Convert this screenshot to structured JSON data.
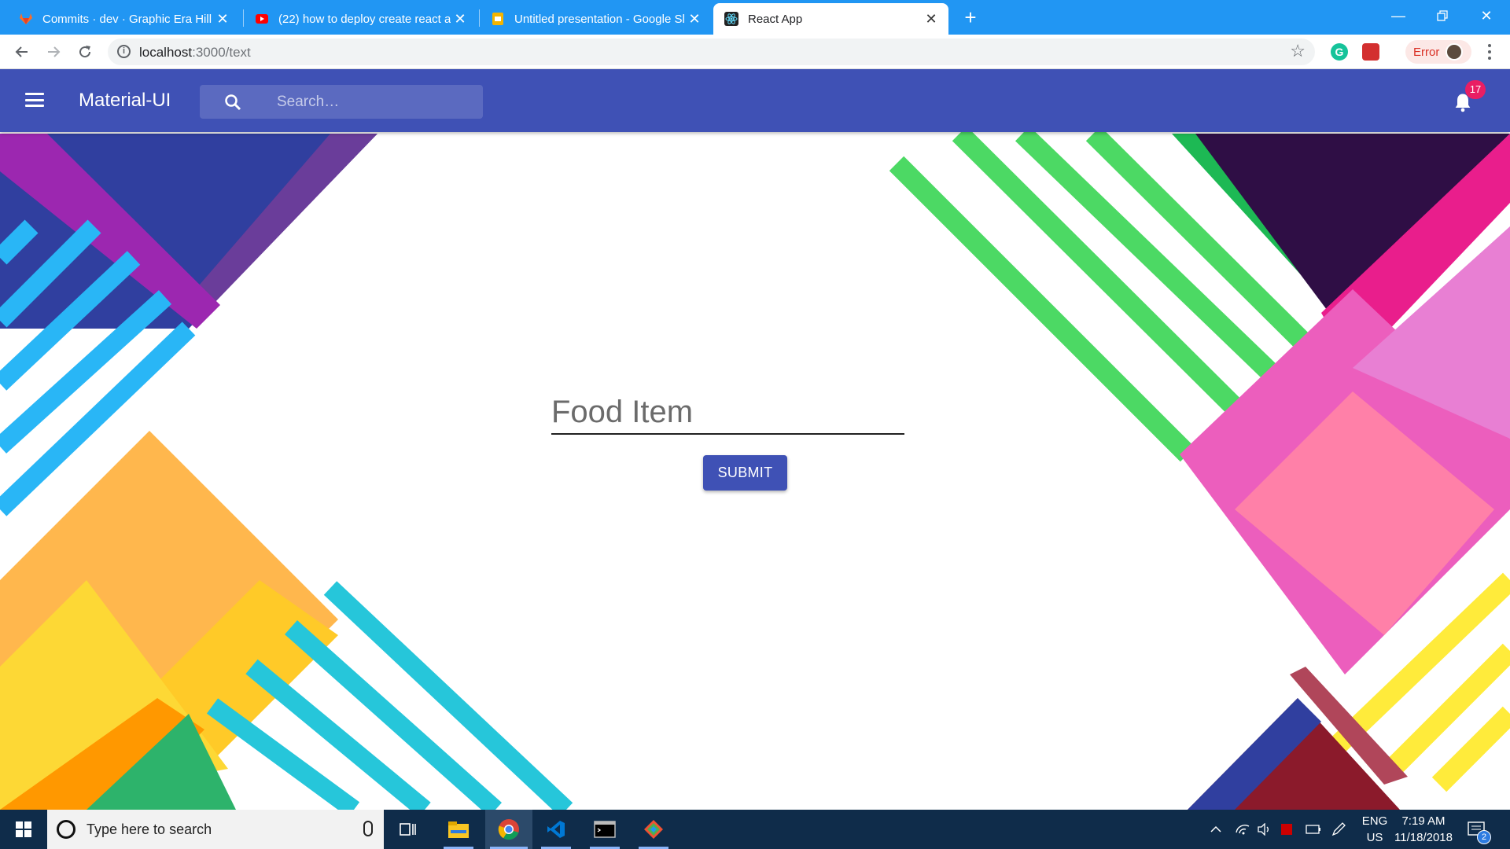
{
  "browser": {
    "tabs": [
      {
        "title": "Commits · dev · Graphic Era Hill U",
        "icon": "gitlab-icon"
      },
      {
        "title": "(22) how to deploy create react a",
        "icon": "youtube-icon"
      },
      {
        "title": "Untitled presentation - Google Sl",
        "icon": "google-slides-icon"
      },
      {
        "title": "React App",
        "icon": "react-icon",
        "active": true
      }
    ],
    "new_tab_label": "+",
    "url_host": "localhost",
    "url_path": ":3000/text",
    "profile_status": "Error"
  },
  "appbar": {
    "brand": "Material-UI",
    "search_placeholder": "Search…",
    "notification_count": "17",
    "color": "#3f51b5"
  },
  "form": {
    "field_placeholder": "Food Item",
    "submit_label": "SUBMIT"
  },
  "taskbar": {
    "search_placeholder": "Type here to search",
    "language": "ENG",
    "region": "US",
    "time": "7:19 AM",
    "date": "11/18/2018",
    "notification_count": "2"
  }
}
